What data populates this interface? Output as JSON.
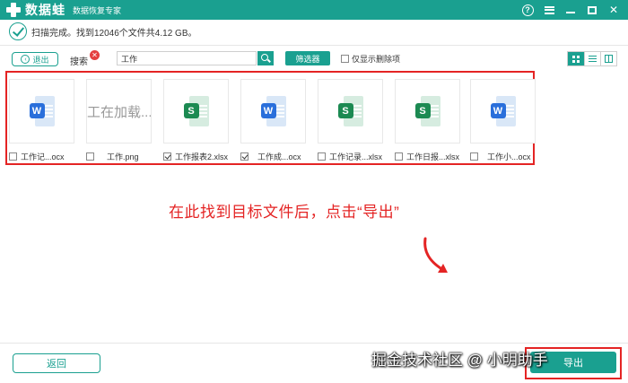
{
  "app": {
    "name": "数据蛙",
    "subtitle": "数据恢复专家"
  },
  "window_controls": {
    "help": "?"
  },
  "status": {
    "text": "扫描完成。找到12046个文件共4.12 GB。"
  },
  "toolbar": {
    "back_label": "退出",
    "search_label": "搜索",
    "search_value": "工作",
    "filter_label": "筛选器",
    "only_deleted_label": "仅显示删除项",
    "only_deleted_checked": false
  },
  "files": [
    {
      "name": "工作记...ocx",
      "type": "word",
      "icon_letter": "W",
      "checked": false
    },
    {
      "name": "工作.png",
      "type": "image-loading",
      "loading_text": "工在加载...",
      "checked": false
    },
    {
      "name": "工作报表2.xlsx",
      "type": "excel",
      "icon_letter": "S",
      "checked": true
    },
    {
      "name": "工作成...ocx",
      "type": "word",
      "icon_letter": "W",
      "checked": true
    },
    {
      "name": "工作记录...xlsx",
      "type": "excel",
      "icon_letter": "S",
      "checked": false
    },
    {
      "name": "工作日报...xlsx",
      "type": "excel",
      "icon_letter": "S",
      "checked": false
    },
    {
      "name": "工作小...ocx",
      "type": "word",
      "icon_letter": "W",
      "checked": false
    }
  ],
  "annotation": {
    "text": "在此找到目标文件后，点击“导出”",
    "color": "#e42424"
  },
  "bottom": {
    "return_label": "返回",
    "export_label": "导出",
    "watermark": "掘金技术社区 @ 小明助手"
  },
  "colors": {
    "accent": "#1aa090",
    "highlight": "#e42424",
    "word": "#2a6fdb",
    "excel": "#1c8a52"
  }
}
